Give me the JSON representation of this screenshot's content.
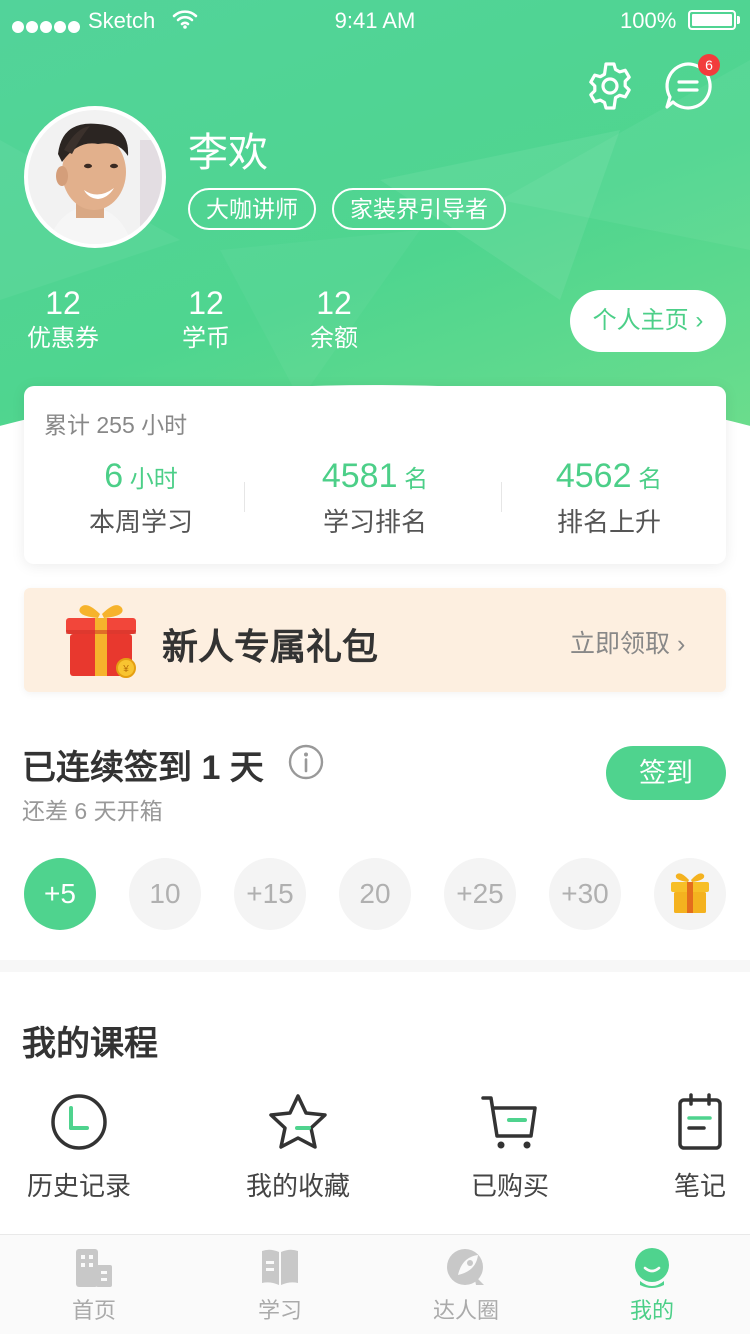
{
  "status_bar": {
    "carrier": "Sketch",
    "time": "9:41 AM",
    "battery": "100%"
  },
  "header": {
    "message_badge": "6"
  },
  "profile": {
    "name": "李欢",
    "tags": [
      "大咖讲师",
      "家装界引导者"
    ],
    "stats": [
      {
        "value": "12",
        "label": "优惠券"
      },
      {
        "value": "12",
        "label": "学币"
      },
      {
        "value": "12",
        "label": "余额"
      }
    ],
    "homepage_button": "个人主页 ›"
  },
  "study": {
    "total": "累计 255 小时",
    "items": [
      {
        "value": "6",
        "unit": " 小时",
        "label": "本周学习"
      },
      {
        "value": "4581",
        "unit": " 名",
        "label": "学习排名"
      },
      {
        "value": "4562",
        "unit": " 名",
        "label": "排名上升"
      }
    ]
  },
  "gift_banner": {
    "title": "新人专属礼包",
    "action": "立即领取 ›"
  },
  "checkin": {
    "title": "已连续签到 1 天",
    "subtitle": "还差 6 天开箱",
    "button": "签到",
    "days": [
      "+5",
      "10",
      "+15",
      "20",
      "+25",
      "+30"
    ],
    "final_reward_icon": "gift-icon"
  },
  "courses": {
    "title": "我的课程",
    "items": [
      {
        "label": "历史记录",
        "icon": "clock-icon"
      },
      {
        "label": "我的收藏",
        "icon": "star-icon"
      },
      {
        "label": "已购买",
        "icon": "cart-icon"
      },
      {
        "label": "笔记",
        "icon": "notebook-icon"
      }
    ]
  },
  "tab_bar": {
    "tabs": [
      {
        "label": "首页",
        "icon": "building-icon"
      },
      {
        "label": "学习",
        "icon": "book-icon"
      },
      {
        "label": "达人圈",
        "icon": "rocket-icon"
      },
      {
        "label": "我的",
        "icon": "profile-icon"
      }
    ],
    "active_index": 3
  },
  "colors": {
    "brand": "#4ccf88",
    "badge": "#f23c3c",
    "gift_banner_bg": "#fdefe0"
  }
}
